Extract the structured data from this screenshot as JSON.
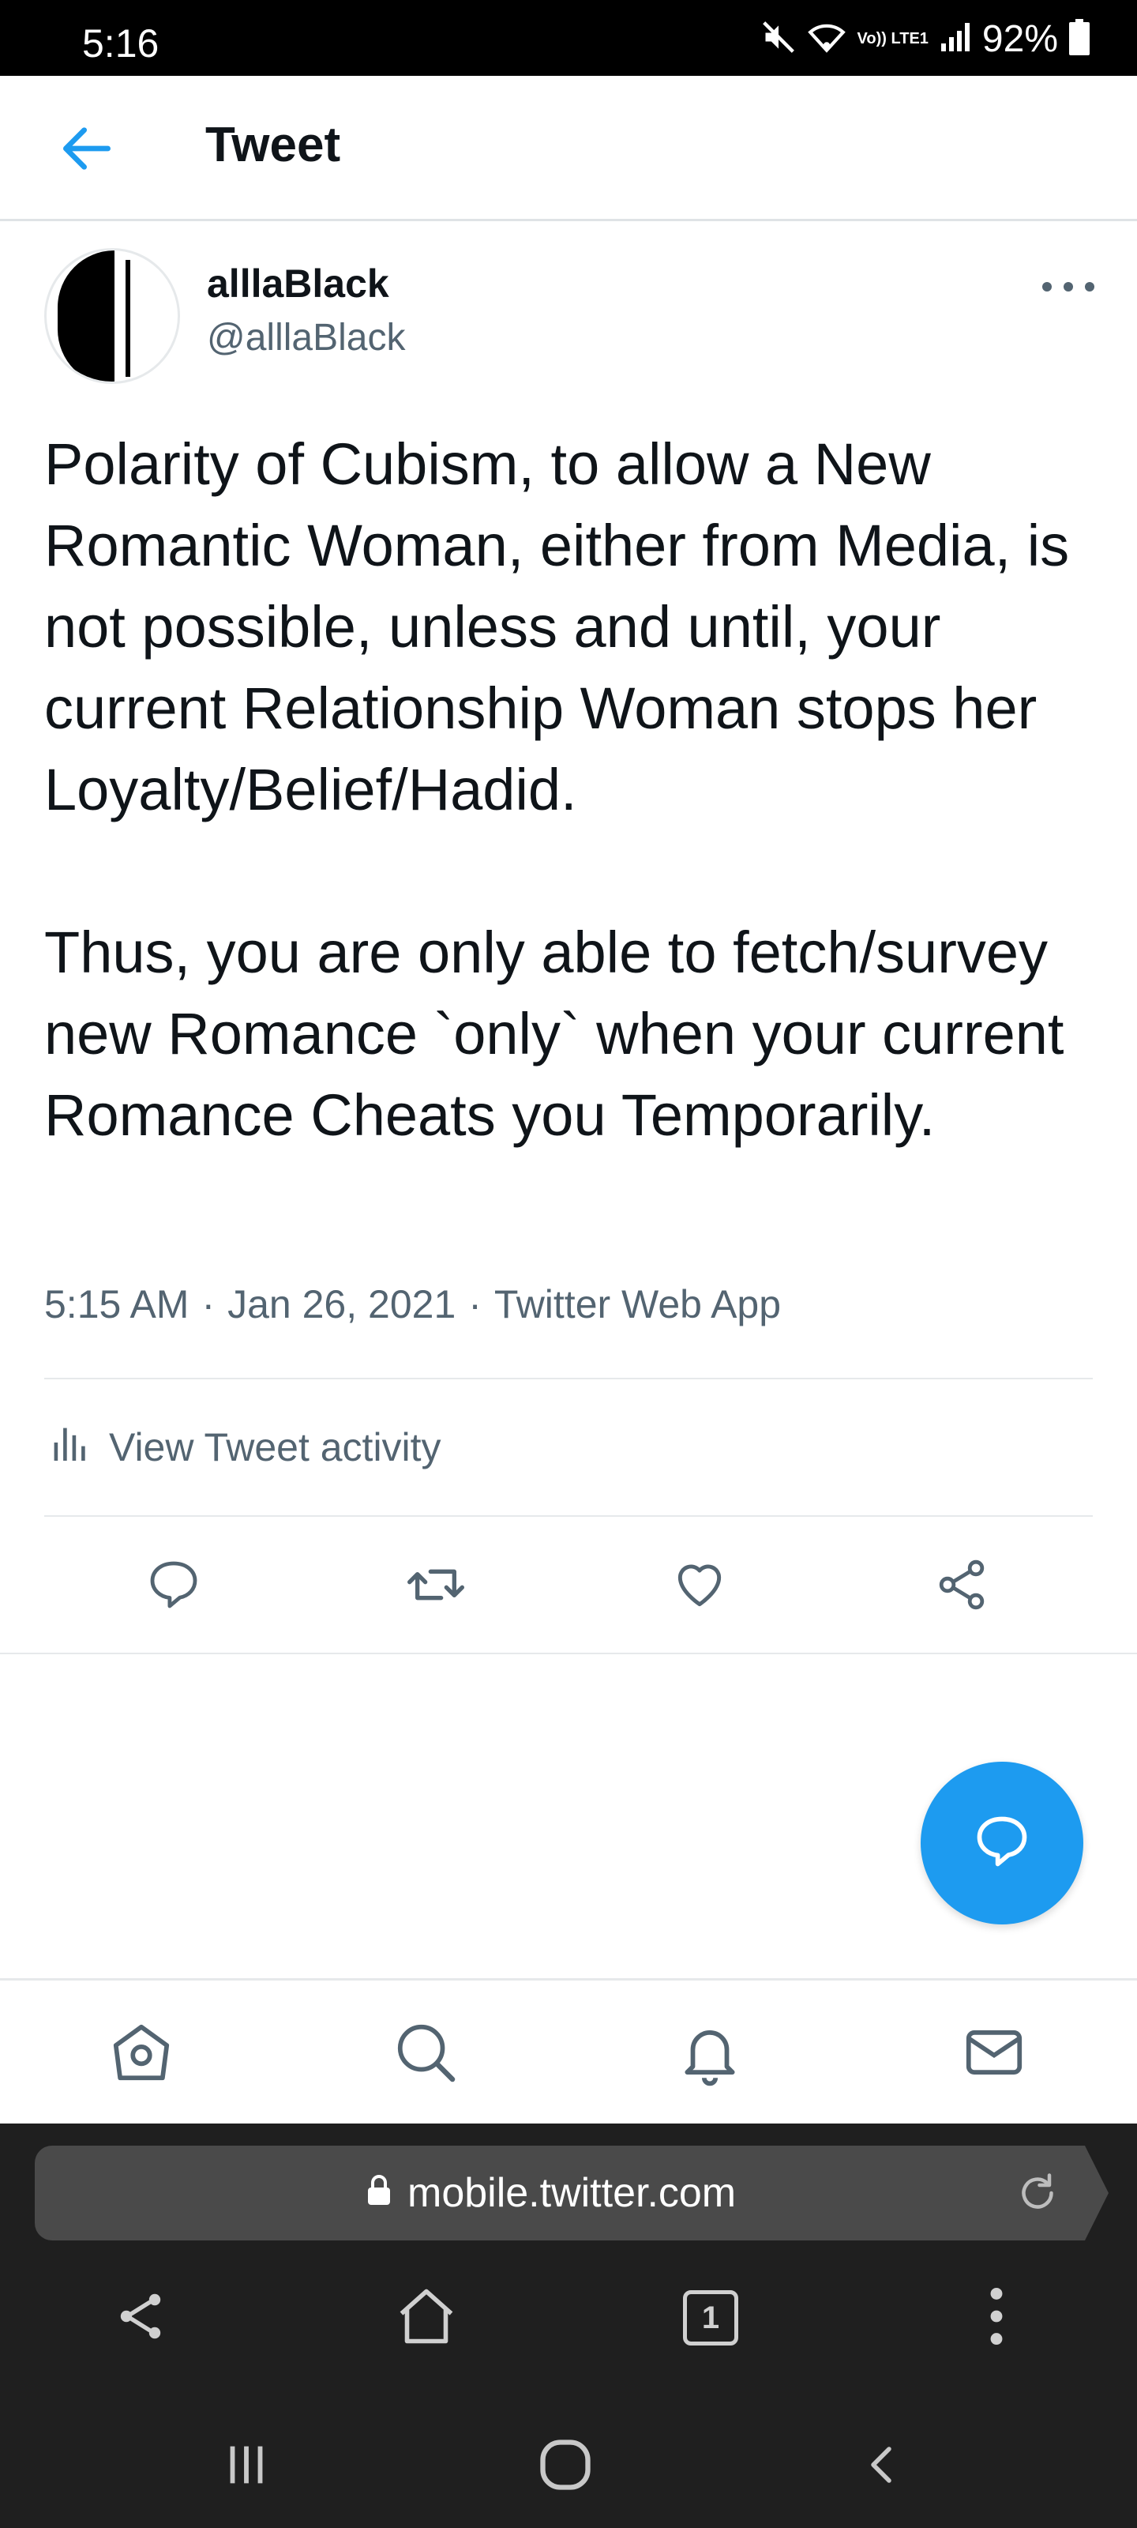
{
  "status_bar": {
    "time": "5:16",
    "network": "Vo)) LTE1",
    "battery": "92%"
  },
  "header": {
    "title": "Tweet",
    "back_icon": "arrow-left-icon"
  },
  "tweet": {
    "display_name": "alllaBlack",
    "handle": "@alllaBlack",
    "paragraphs": [
      "Polarity of Cubism, to allow a New Romantic Woman, either from Media, is not possible, unless and until, your current Relationship Woman stops her Loyalty/Belief/Hadid.",
      "Thus, you are only able to fetch/survey new Romance `only` when your current Romance Cheats you Temporarily."
    ],
    "time": "5:15 AM",
    "date": "Jan 26, 2021",
    "source": "Twitter Web App",
    "separator": "·",
    "activity_label": "View Tweet activity"
  },
  "actions": [
    "reply-icon",
    "retweet-icon",
    "like-icon",
    "share-icon"
  ],
  "bottom_tabs": [
    "home-icon",
    "search-icon",
    "notifications-icon",
    "messages-icon"
  ],
  "browser": {
    "url": "mobile.twitter.com",
    "tab_count": "1"
  },
  "colors": {
    "accent": "#1d9bf0",
    "secondary_text": "#536471",
    "icon": "#536471"
  }
}
